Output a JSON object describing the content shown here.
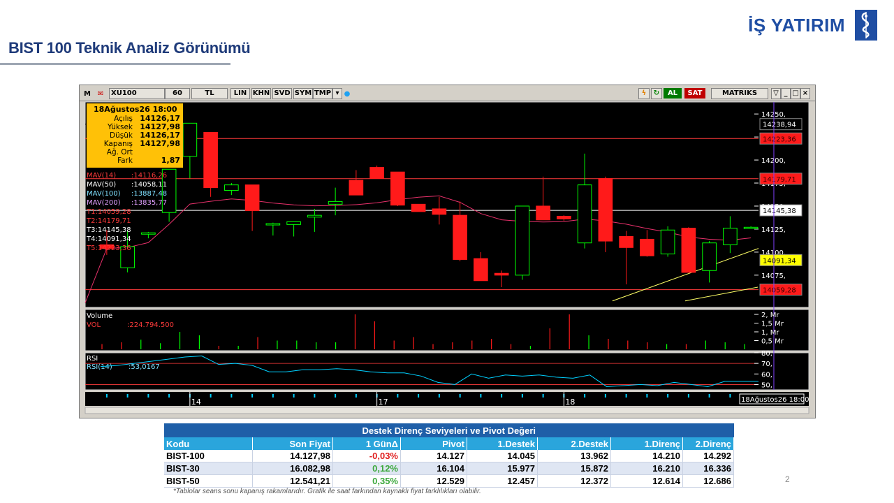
{
  "slide": {
    "title": "BIST 100 Teknik Analiz Görünümü",
    "page_number": "2"
  },
  "brand": {
    "name": "İŞ YATIRIM",
    "mark_icon": "is-bank-logo-icon",
    "color": "#1f4ea3"
  },
  "toolbar": {
    "m": "M",
    "symbol": "XU100",
    "period": "60",
    "currency": "TL",
    "lin": "LIN",
    "khn": "KHN",
    "svd": "SVD",
    "sym": "SYM",
    "tmp": "TMP",
    "al": "AL",
    "sat": "SAT",
    "brand": "MATRIKS"
  },
  "chart_data": {
    "type": "candlestick",
    "info_box": {
      "date": "18Ağustos26 18:00",
      "rows": [
        {
          "label": "Açılış",
          "value": "14126,17"
        },
        {
          "label": "Yüksek",
          "value": "14127,98"
        },
        {
          "label": "Düşük",
          "value": "14126,17"
        },
        {
          "label": "Kapanış",
          "value": "14127,98"
        },
        {
          "label": "Ağ. Ort",
          "value": ""
        },
        {
          "label": "Fark",
          "value": "1,87"
        }
      ]
    },
    "indicators": [
      {
        "label": "MAV(14)",
        "value": ":14116,26",
        "color": "#ff3b3b"
      },
      {
        "label": "MAV(50)",
        "value": ":14058,11",
        "color": "#ffffff"
      },
      {
        "label": "MAV(100)",
        "value": ":13887,48",
        "color": "#7fe0ff"
      },
      {
        "label": "MAV(200)",
        "value": ":13835,77",
        "color": "#e0a0ff"
      },
      {
        "label": "T1:14059,28",
        "value": "",
        "color": "#ff3b3b"
      },
      {
        "label": "T2:14179,71",
        "value": "",
        "color": "#ff3b3b"
      },
      {
        "label": "T3:14145,38",
        "value": "",
        "color": "#ffffff"
      },
      {
        "label": "T4:14091,34",
        "value": "",
        "color": "#ffffff"
      },
      {
        "label": "T5:14223,36",
        "value": "",
        "color": "#ff3b3b"
      }
    ],
    "ylim": [
      14040,
      14263
    ],
    "price_ticks": [
      "14250,",
      "14225,",
      "14200,",
      "14175,",
      "14150,",
      "14125,",
      "14100,",
      "14075,"
    ],
    "price_tick_values": [
      14250,
      14225,
      14200,
      14175,
      14150,
      14125,
      14100,
      14075
    ],
    "levels": [
      {
        "value": 14238.94,
        "label": "14238,94",
        "line": "#000000",
        "bg": "#000000",
        "fg": "#ffffff"
      },
      {
        "value": 14223.36,
        "label": "14223,36",
        "line": "#ff3b3b",
        "bg": "#ff1a1a",
        "fg": "#3a0000"
      },
      {
        "value": 14179.71,
        "label": "14179,71",
        "line": "#ff3b3b",
        "bg": "#ff1a1a",
        "fg": "#3a0000"
      },
      {
        "value": 14145.38,
        "label": "14145,38",
        "line": "#ffffff",
        "bg": "#ffffff",
        "fg": "#000000"
      },
      {
        "value": 14091.34,
        "label": "14091,34",
        "line": "none",
        "bg": "#ffff00",
        "fg": "#000000"
      },
      {
        "value": 14059.28,
        "label": "14059,28",
        "line": "#ff3b3b",
        "bg": "#ff1a1a",
        "fg": "#3a0000"
      }
    ],
    "candles": [
      [
        14108,
        14124,
        14097,
        14104
      ],
      [
        14083,
        14123,
        14078,
        14106
      ],
      [
        14120,
        14122,
        14115,
        14121
      ],
      [
        14143,
        14190,
        14133,
        14190
      ],
      [
        14204,
        14235,
        14180,
        14240
      ],
      [
        14230,
        14230,
        14160,
        14170
      ],
      [
        14167,
        14175,
        14162,
        14173
      ],
      [
        14173,
        14173,
        14123,
        14145
      ],
      [
        14131,
        14132,
        14118,
        14131
      ],
      [
        14130,
        14133,
        14117,
        14133
      ],
      [
        14138,
        14147,
        14122,
        14140
      ],
      [
        14152,
        14170,
        14140,
        14155
      ],
      [
        14178,
        14189,
        14172,
        14162
      ],
      [
        14192,
        14194,
        14200,
        14180
      ],
      [
        14187,
        14187,
        14150,
        14151
      ],
      [
        14152,
        14150,
        14146,
        14144
      ],
      [
        14147,
        14160,
        14130,
        14141
      ],
      [
        14140,
        14155,
        14090,
        14092
      ],
      [
        14093,
        14100,
        14080,
        14069
      ],
      [
        14077,
        14080,
        14062,
        14075
      ],
      [
        14075,
        14150,
        14070,
        14150
      ],
      [
        14150,
        14182,
        14146,
        14135
      ],
      [
        14139,
        14140,
        14134,
        14136
      ],
      [
        14110,
        14207,
        14104,
        14173
      ],
      [
        14180,
        14182,
        14100,
        14112
      ],
      [
        14117,
        14123,
        14065,
        14105
      ],
      [
        14114,
        14124,
        14095,
        14096
      ],
      [
        14098,
        14128,
        14095,
        14124
      ],
      [
        14126,
        14127,
        14082,
        14078
      ],
      [
        14080,
        14112,
        14067,
        14110
      ],
      [
        14108,
        14139,
        14099,
        14126
      ],
      [
        14126,
        14128,
        14126,
        14127
      ]
    ],
    "volume_label": "Volume",
    "vol_label": "VOL",
    "vol_value": ":224.794.500",
    "volume_max": 2.2,
    "volume_ticks": [
      "2, Mr",
      "1,5 Mr",
      "1, Mr",
      "0,5 Mr"
    ],
    "volume_tick_values": [
      2,
      1.5,
      1,
      0.5
    ],
    "volumes": [
      0.3,
      0.4,
      0.55,
      0.35,
      1.0,
      0.8,
      0.2,
      0.2,
      0.7,
      0.5,
      0.5,
      0.4,
      0.4,
      2.0,
      1.6,
      0.5,
      0.7,
      0.3,
      0.4,
      0.5,
      0.6,
      0.3,
      0.2,
      1.2,
      2.0,
      0.8,
      0.6,
      0.5,
      0.4,
      0.3,
      0.3,
      0.5,
      0.4,
      0.3
    ],
    "rsi_label": "RSI",
    "rsi_indicator": "RSI(14)",
    "rsi_value": ":53,0167",
    "rsi_range": [
      45,
      80
    ],
    "rsi_ticks": [
      "80,",
      "70,",
      "60,",
      "50,"
    ],
    "rsi_tick_values": [
      80,
      70,
      60,
      50
    ],
    "rsi": [
      67,
      68,
      70,
      72,
      74,
      76,
      77,
      69,
      70,
      68,
      62,
      62,
      64,
      64,
      65,
      64,
      62,
      61,
      61,
      58,
      52,
      50,
      60,
      56,
      59,
      58,
      59,
      57,
      56,
      59,
      48,
      49,
      50,
      49,
      52,
      50,
      48,
      53,
      53,
      53
    ],
    "x_ticks": [
      "14",
      "17",
      "18"
    ],
    "x_tick_index": [
      4.5,
      13.5,
      22.5
    ],
    "x_readout": "18Ağustos26 18:00",
    "colors": {
      "up": "#00ff00",
      "down": "#ff1a1a",
      "ma": "#e8316b",
      "trend": "#ffff66",
      "rsi": "#00d0ff",
      "bg": "#000000"
    }
  },
  "table": {
    "title": "Destek Direnç Seviyeleri ve Pivot Değeri",
    "headers": [
      "Kodu",
      "Son Fiyat",
      "1 GünΔ",
      "Pivot",
      "1.Destek",
      "2.Destek",
      "1.Direnç",
      "2.Direnç"
    ],
    "rows": [
      {
        "code": "BIST-100",
        "last": "14.127,98",
        "change": "-0,03%",
        "dir": "neg",
        "pivot": "14.127",
        "s1": "14.045",
        "s2": "13.962",
        "r1": "14.210",
        "r2": "14.292"
      },
      {
        "code": "BIST-30",
        "last": "16.082,98",
        "change": "0,12%",
        "dir": "pos",
        "pivot": "16.104",
        "s1": "15.977",
        "s2": "15.872",
        "r1": "16.210",
        "r2": "16.336"
      },
      {
        "code": "BIST-50",
        "last": "12.541,21",
        "change": "0,35%",
        "dir": "pos",
        "pivot": "12.529",
        "s1": "12.457",
        "s2": "12.372",
        "r1": "12.614",
        "r2": "12.686"
      }
    ]
  },
  "footnote": "*Tablolar seans sonu kapanış rakamlarıdır. Grafik ile saat farkından kaynaklı fiyat farklılıkları olabilir."
}
